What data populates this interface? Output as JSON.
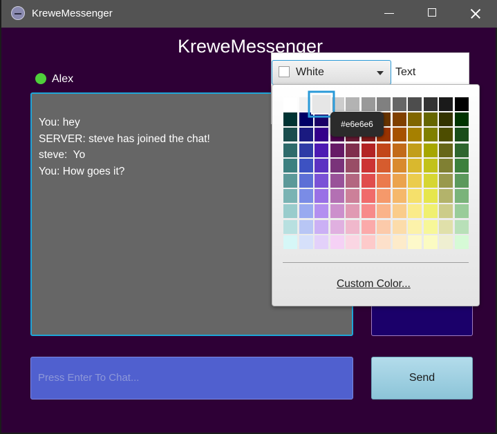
{
  "window": {
    "title": "KreweMessenger"
  },
  "header": {
    "title": "KreweMessenger"
  },
  "user": {
    "name": "Alex",
    "status_color": "#4fcf3b"
  },
  "chat": {
    "messages": [
      "You: hey",
      "SERVER: steve has joined the chat!",
      "steve:  Yo",
      "You: How goes it?"
    ]
  },
  "input": {
    "placeholder": "Press Enter To Chat..."
  },
  "send": {
    "label": "Send"
  },
  "color_picker": {
    "selected_label": "White",
    "text_label": "Text",
    "tooltip": "#e6e6e6",
    "custom_label": "Custom Color...",
    "selected_color": "#e6e6e6",
    "rows": [
      [
        "#ffffff",
        "#f2f2f2",
        "#e6e6e6",
        "#cccccc",
        "#b3b3b3",
        "#999999",
        "#808080",
        "#666666",
        "#4d4d4d",
        "#333333",
        "#1a1a1a",
        "#000000"
      ],
      [
        "#003333",
        "#000066",
        "#1a0066",
        "#330033",
        "#330000",
        "#660000",
        "#663300",
        "#804000",
        "#806600",
        "#666600",
        "#333300",
        "#003300"
      ],
      [
        "#1a4d4d",
        "#1a1a80",
        "#33008a",
        "#4d004d",
        "#661a33",
        "#801a1a",
        "#993300",
        "#a65200",
        "#a68000",
        "#808000",
        "#4d4d00",
        "#1a4d1a"
      ],
      [
        "#2e6b6b",
        "#2e3ba6",
        "#4d1ab3",
        "#661a66",
        "#802e4d",
        "#b32424",
        "#c2461a",
        "#c26b1a",
        "#c29e1a",
        "#a6a600",
        "#666619",
        "#2e662e"
      ],
      [
        "#3d8080",
        "#3d52c2",
        "#5c33c2",
        "#7a337a",
        "#994d66",
        "#cc3333",
        "#d65c2e",
        "#d98a2e",
        "#d9b82e",
        "#c2c21a",
        "#808033",
        "#3d803d"
      ],
      [
        "#5c9999",
        "#5c6fd6",
        "#7a52d6",
        "#995299",
        "#b36680",
        "#e04d4d",
        "#eb7a4d",
        "#eba34d",
        "#ebcc4d",
        "#d6d633",
        "#99994d",
        "#5c995c"
      ],
      [
        "#7ab3b3",
        "#7a8ce6",
        "#9970e6",
        "#b370b3",
        "#cc8099",
        "#f06b6b",
        "#f5996b",
        "#f5b86b",
        "#f5e06b",
        "#e6e64d",
        "#b3b36b",
        "#7ab37a"
      ],
      [
        "#99cccc",
        "#99aaf0",
        "#b38ff0",
        "#cc8fcc",
        "#e09ab3",
        "#f78a8a",
        "#fab38a",
        "#facc8a",
        "#faeb8a",
        "#f0f070",
        "#cccc8a",
        "#99cc99"
      ],
      [
        "#b8e0e0",
        "#b8c6f5",
        "#cbb0f5",
        "#e0b0e0",
        "#f0b8cc",
        "#fbaaaa",
        "#fccaaa",
        "#fcdcaa",
        "#fcf2aa",
        "#f7f799",
        "#e0e0aa",
        "#b8e0b8"
      ],
      [
        "#d6f7f7",
        "#d6e0fa",
        "#e3d1fa",
        "#f5d1f5",
        "#fad6e3",
        "#fdcaca",
        "#fde0ca",
        "#fdebca",
        "#fdf9ca",
        "#fbfbc2",
        "#efefd1",
        "#d6fad6"
      ]
    ]
  }
}
